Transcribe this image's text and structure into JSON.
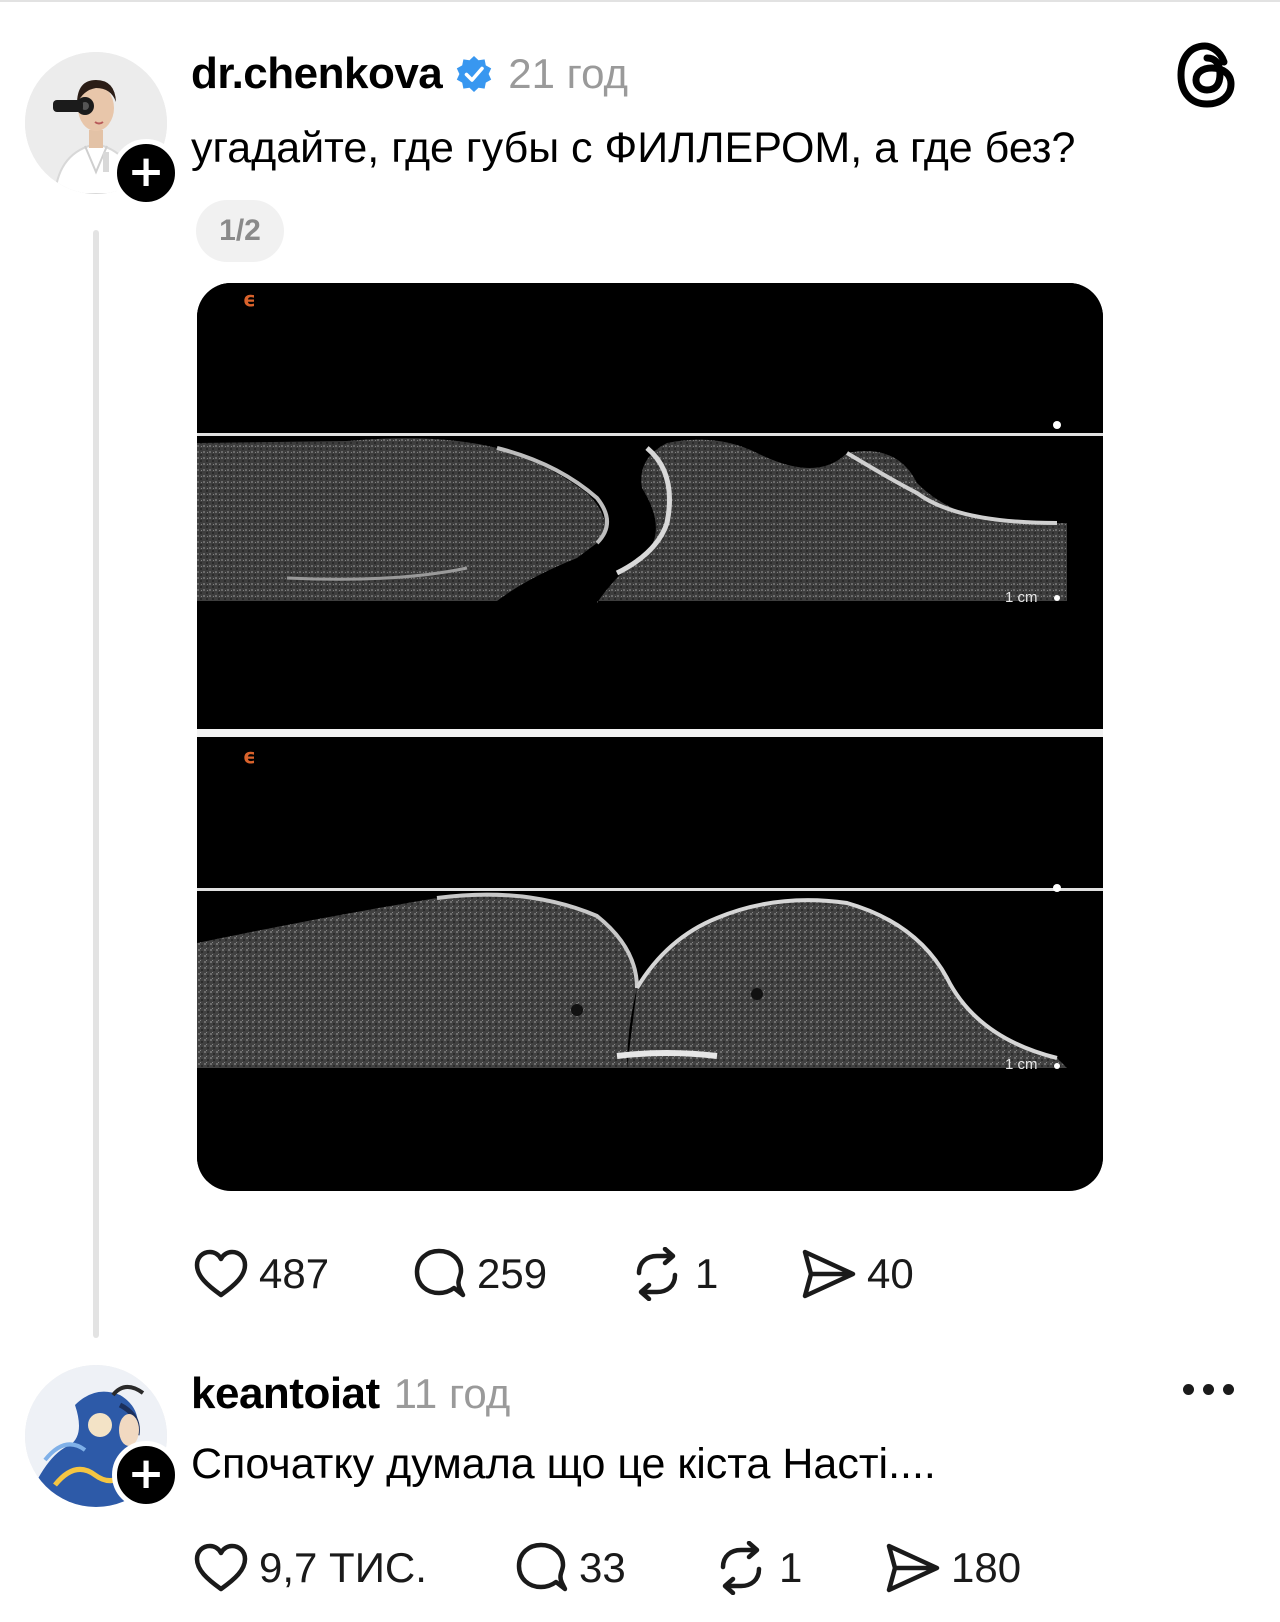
{
  "post": {
    "username": "dr.chenkova",
    "time": "21 год",
    "text": "угадайте, где губы с ФИЛЛЕРОМ, а где без?",
    "media_counter": "1/2",
    "media": {
      "top_scale_label": "1 cm",
      "bottom_scale_label": "1 cm"
    },
    "actions": {
      "likes": "487",
      "replies": "259",
      "reposts": "1",
      "shares": "40"
    }
  },
  "reply": {
    "username": "keantoiat",
    "time": "11 год",
    "text": "Спочатку думала що це кіста Насті....",
    "actions": {
      "likes": "9,7 ТИС.",
      "replies": "33",
      "reposts": "1",
      "shares": "180"
    }
  },
  "colors": {
    "verified": "#3897f0",
    "timestamp": "#9a9a9a",
    "thread_line": "#e3e3e3",
    "ultrasound_logo": "#d9622b"
  },
  "icons": [
    "plus-icon",
    "verified-badge-icon",
    "threads-logo-icon",
    "heart-icon",
    "comment-icon",
    "repost-icon",
    "share-icon",
    "more-icon"
  ]
}
